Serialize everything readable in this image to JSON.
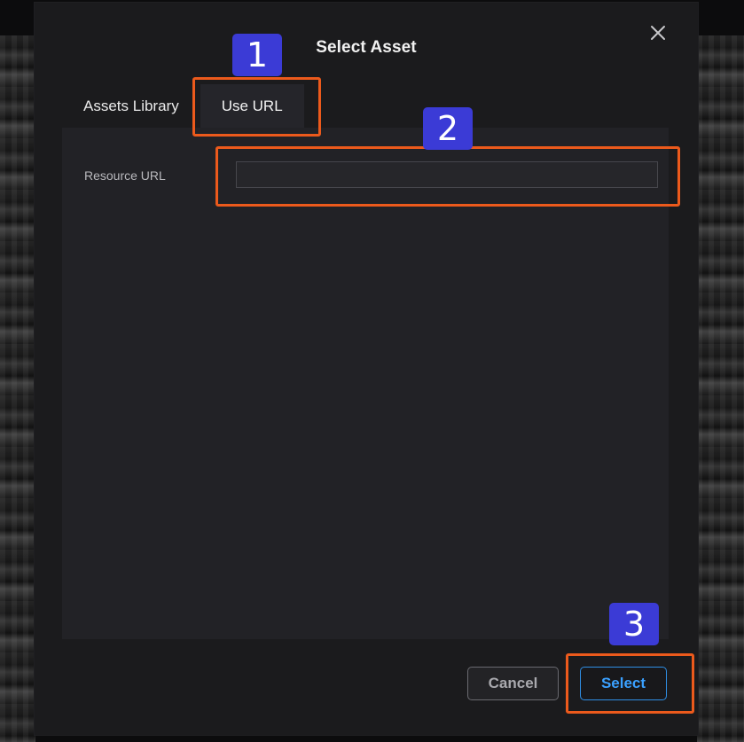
{
  "dialog": {
    "title": "Select Asset",
    "close_icon": "close-icon"
  },
  "tabs": [
    {
      "label": "Assets Library",
      "active": false
    },
    {
      "label": "Use URL",
      "active": true
    }
  ],
  "form": {
    "resource_url_label": "Resource URL",
    "resource_url_value": "",
    "resource_url_placeholder": ""
  },
  "footer": {
    "cancel_label": "Cancel",
    "select_label": "Select"
  },
  "annotations": {
    "step1": "1",
    "step2": "2",
    "step3": "3"
  },
  "colors": {
    "accent": "#2f8fe6",
    "highlight": "#ec5a1c",
    "badge": "#3b3bd6"
  }
}
